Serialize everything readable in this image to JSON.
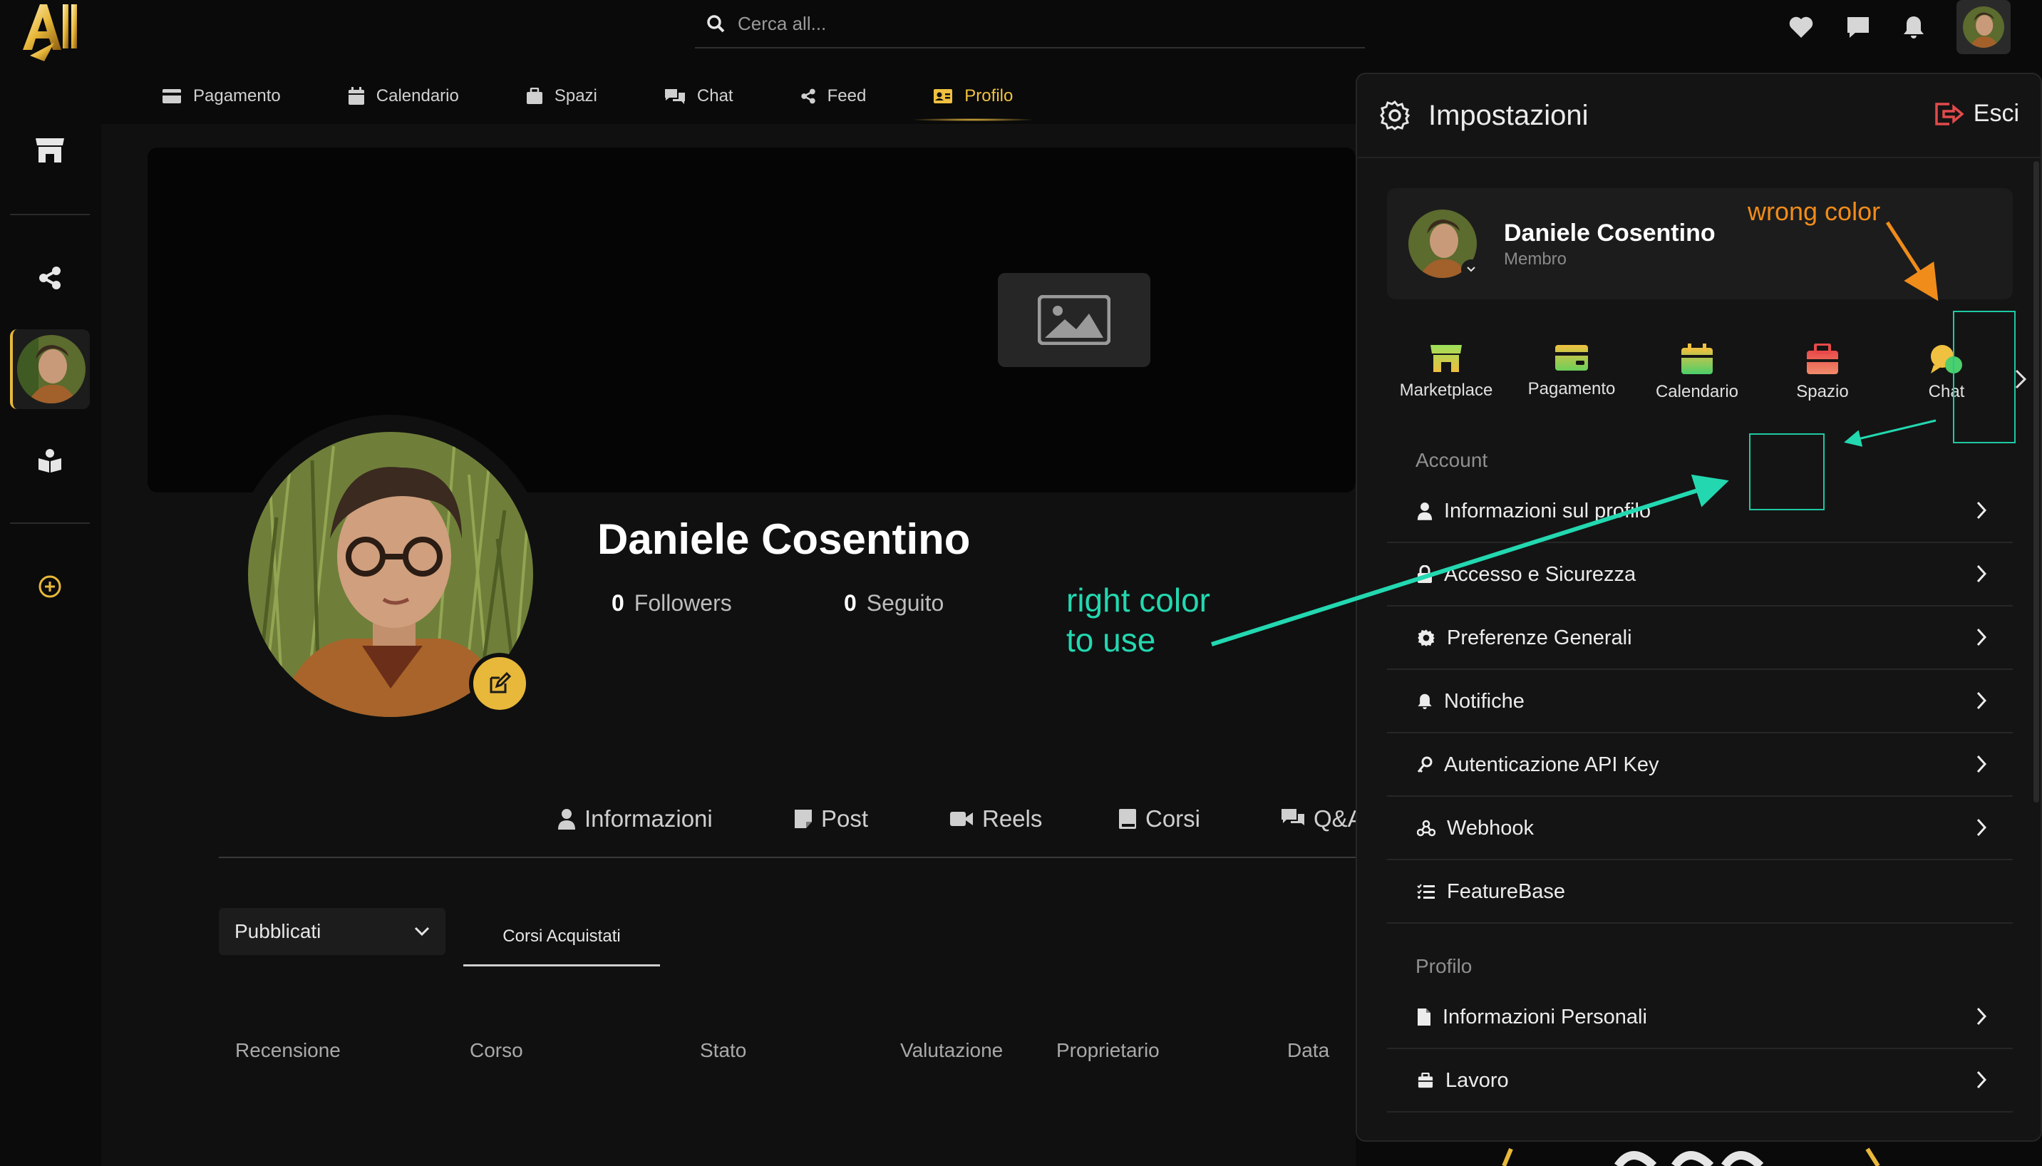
{
  "colors": {
    "accent": "#e8b83a",
    "annotation_green": "#23d8b0",
    "annotation_orange": "#f08c1a",
    "exit_red": "#e24a4a"
  },
  "search": {
    "placeholder": "Cerca all..."
  },
  "nav": {
    "items": [
      {
        "label": "Pagamento",
        "icon": "credit-card-icon"
      },
      {
        "label": "Calendario",
        "icon": "calendar-icon"
      },
      {
        "label": "Spazi",
        "icon": "suitcase-icon"
      },
      {
        "label": "Chat",
        "icon": "chat-bubbles-icon"
      },
      {
        "label": "Feed",
        "icon": "share-icon"
      },
      {
        "label": "Profilo",
        "icon": "id-card-icon",
        "active": true
      }
    ]
  },
  "profile": {
    "name": "Daniele Cosentino",
    "followers_count": "0",
    "followers_label": "Followers",
    "following_count": "0",
    "following_label": "Seguito"
  },
  "tabs": [
    {
      "label": "Informazioni",
      "icon": "user-icon"
    },
    {
      "label": "Post",
      "icon": "note-icon"
    },
    {
      "label": "Reels",
      "icon": "video-camera-icon"
    },
    {
      "label": "Corsi",
      "icon": "book-icon"
    },
    {
      "label": "Q&A",
      "icon": "question-bubbles-icon"
    }
  ],
  "filter": {
    "selected": "Pubblicati",
    "subtab": "Corsi Acquistati"
  },
  "table_headers": [
    "Recensione",
    "Corso",
    "Stato",
    "Valutazione",
    "Proprietario",
    "Data"
  ],
  "settings": {
    "title": "Impostazioni",
    "exit_label": "Esci",
    "user": {
      "name": "Daniele Cosentino",
      "role": "Membro"
    },
    "apps": [
      {
        "label": "Marketplace",
        "icon": "store-icon"
      },
      {
        "label": "Pagamento",
        "icon": "wallet-icon"
      },
      {
        "label": "Calendario",
        "icon": "calendar-icon"
      },
      {
        "label": "Spazio",
        "icon": "box-icon"
      },
      {
        "label": "Chat",
        "icon": "chat-icon"
      }
    ],
    "account_label": "Account",
    "account_items": [
      {
        "label": "Informazioni sul profilo",
        "icon": "user-icon"
      },
      {
        "label": "Accesso e Sicurezza",
        "icon": "lock-icon"
      },
      {
        "label": "Preferenze Generali",
        "icon": "gear-icon"
      },
      {
        "label": "Notifiche",
        "icon": "bell-icon"
      },
      {
        "label": "Autenticazione API Key",
        "icon": "key-icon"
      },
      {
        "label": "Webhook",
        "icon": "webhook-icon"
      },
      {
        "label": "FeatureBase",
        "icon": "list-icon"
      }
    ],
    "profile_label": "Profilo",
    "profile_items": [
      {
        "label": "Informazioni Personali",
        "icon": "document-icon"
      },
      {
        "label": "Lavoro",
        "icon": "briefcase-icon"
      }
    ]
  },
  "annotations": {
    "wrong": "wrong color",
    "right_line1": "right color",
    "right_line2": "to use"
  }
}
